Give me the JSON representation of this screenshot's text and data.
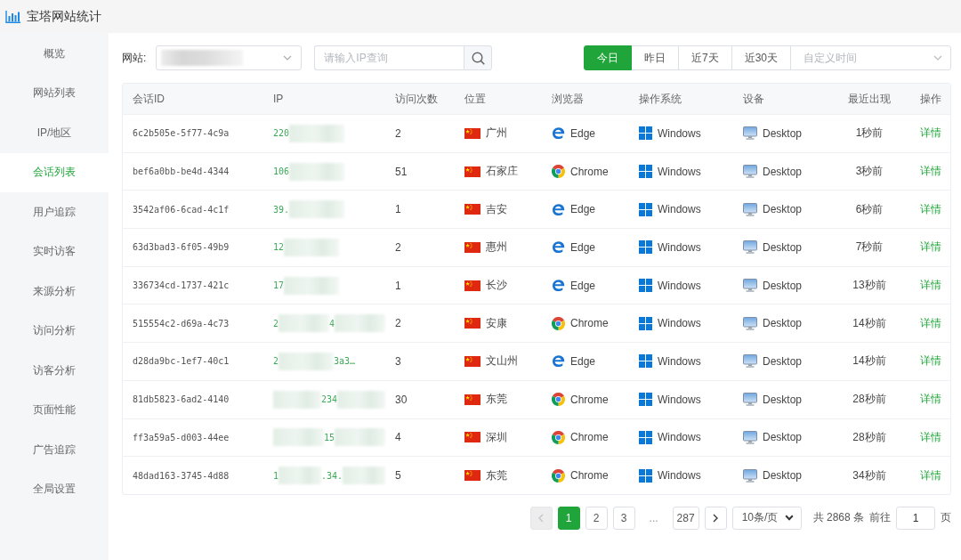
{
  "app": {
    "title": "宝塔网站统计"
  },
  "sidebar": {
    "items": [
      {
        "label": "概览",
        "selected": false
      },
      {
        "label": "网站列表",
        "selected": false
      },
      {
        "label": "IP/地区",
        "selected": false
      },
      {
        "label": "会话列表",
        "selected": true
      },
      {
        "label": "用户追踪",
        "selected": false
      },
      {
        "label": "实时访客",
        "selected": false
      },
      {
        "label": "来源分析",
        "selected": false
      },
      {
        "label": "访问分析",
        "selected": false
      },
      {
        "label": "访客分析",
        "selected": false
      },
      {
        "label": "页面性能",
        "selected": false
      },
      {
        "label": "广告追踪",
        "selected": false
      },
      {
        "label": "全局设置",
        "selected": false
      }
    ]
  },
  "filters": {
    "site": {
      "label": "网站:"
    },
    "ip_search": {
      "placeholder": "请输入IP查询"
    },
    "date_ranges": [
      {
        "label": "今日",
        "selected": true
      },
      {
        "label": "昨日",
        "selected": false
      },
      {
        "label": "近7天",
        "selected": false
      },
      {
        "label": "近30天",
        "selected": false
      }
    ],
    "custom_range": {
      "placeholder": "自定义时间"
    }
  },
  "table": {
    "columns": [
      "会话ID",
      "IP",
      "访问次数",
      "位置",
      "浏览器",
      "操作系统",
      "设备",
      "最近出现",
      "操作"
    ],
    "rows": [
      {
        "session_id": "6c2b505e-5f77-4c9a",
        "ip": [
          {
            "kind": "text",
            "text": "220"
          },
          {
            "kind": "mask"
          }
        ],
        "visits": "2",
        "location": "广州",
        "browser": {
          "kind": "edge",
          "label": "Edge"
        },
        "os": "Windows",
        "device": "Desktop",
        "last_seen": "1秒前",
        "action": "详情"
      },
      {
        "session_id": "bef6a0bb-be4d-4344",
        "ip": [
          {
            "kind": "text",
            "text": "106"
          },
          {
            "kind": "mask"
          }
        ],
        "visits": "51",
        "location": "石家庄",
        "browser": {
          "kind": "chrome",
          "label": "Chrome"
        },
        "os": "Windows",
        "device": "Desktop",
        "last_seen": "3秒前",
        "action": "详情"
      },
      {
        "session_id": "3542af06-6cad-4c1f",
        "ip": [
          {
            "kind": "text",
            "text": "39."
          },
          {
            "kind": "mask"
          }
        ],
        "visits": "1",
        "location": "吉安",
        "browser": {
          "kind": "edge",
          "label": "Edge"
        },
        "os": "Windows",
        "device": "Desktop",
        "last_seen": "6秒前",
        "action": "详情"
      },
      {
        "session_id": "63d3bad3-6f05-49b9",
        "ip": [
          {
            "kind": "text",
            "text": "12"
          },
          {
            "kind": "mask"
          }
        ],
        "visits": "2",
        "location": "惠州",
        "browser": {
          "kind": "edge",
          "label": "Edge"
        },
        "os": "Windows",
        "device": "Desktop",
        "last_seen": "7秒前",
        "action": "详情"
      },
      {
        "session_id": "336734cd-1737-421c",
        "ip": [
          {
            "kind": "text",
            "text": "17"
          },
          {
            "kind": "mask"
          }
        ],
        "visits": "1",
        "location": "长沙",
        "browser": {
          "kind": "edge",
          "label": "Edge"
        },
        "os": "Windows",
        "device": "Desktop",
        "last_seen": "13秒前",
        "action": "详情"
      },
      {
        "session_id": "515554c2-d69a-4c73",
        "ip": [
          {
            "kind": "text",
            "text": "2"
          },
          {
            "kind": "mask"
          },
          {
            "kind": "text",
            "text": "4"
          },
          {
            "kind": "mask"
          }
        ],
        "visits": "2",
        "location": "安康",
        "browser": {
          "kind": "chrome",
          "label": "Chrome"
        },
        "os": "Windows",
        "device": "Desktop",
        "last_seen": "14秒前",
        "action": "详情"
      },
      {
        "session_id": "d28da9bc-1ef7-40c1",
        "ip": [
          {
            "kind": "text",
            "text": "2"
          },
          {
            "kind": "mask"
          },
          {
            "kind": "text",
            "text": "3a3…"
          }
        ],
        "visits": "3",
        "location": "文山州",
        "browser": {
          "kind": "edge",
          "label": "Edge"
        },
        "os": "Windows",
        "device": "Desktop",
        "last_seen": "14秒前",
        "action": "详情"
      },
      {
        "session_id": "81db5823-6ad2-4140",
        "ip": [
          {
            "kind": "mask"
          },
          {
            "kind": "text",
            "text": "234"
          },
          {
            "kind": "mask"
          }
        ],
        "visits": "30",
        "location": "东莞",
        "browser": {
          "kind": "chrome",
          "label": "Chrome"
        },
        "os": "Windows",
        "device": "Desktop",
        "last_seen": "28秒前",
        "action": "详情"
      },
      {
        "session_id": "ff3a59a5-d003-44ee",
        "ip": [
          {
            "kind": "mask"
          },
          {
            "kind": "text",
            "text": "15"
          },
          {
            "kind": "mask"
          }
        ],
        "visits": "4",
        "location": "深圳",
        "browser": {
          "kind": "chrome",
          "label": "Chrome"
        },
        "os": "Windows",
        "device": "Desktop",
        "last_seen": "28秒前",
        "action": "详情"
      },
      {
        "session_id": "48dad163-3745-4d88",
        "ip": [
          {
            "kind": "text",
            "text": "1"
          },
          {
            "kind": "mask"
          },
          {
            "kind": "text",
            "text": ".34."
          },
          {
            "kind": "mask"
          }
        ],
        "visits": "5",
        "location": "东莞",
        "browser": {
          "kind": "chrome",
          "label": "Chrome"
        },
        "os": "Windows",
        "device": "Desktop",
        "last_seen": "34秒前",
        "action": "详情"
      }
    ]
  },
  "pagination": {
    "prev_disabled": true,
    "pages": [
      {
        "kind": "page",
        "label": "1",
        "selected": true
      },
      {
        "kind": "page",
        "label": "2",
        "selected": false
      },
      {
        "kind": "page",
        "label": "3",
        "selected": false
      },
      {
        "kind": "ellipsis",
        "label": "...",
        "selected": false
      },
      {
        "kind": "page",
        "label": "287",
        "selected": false
      }
    ],
    "page_size": "10条/页",
    "total": "共 2868 条",
    "goto_label": "前往",
    "goto_value": "1",
    "goto_suffix": "页"
  }
}
